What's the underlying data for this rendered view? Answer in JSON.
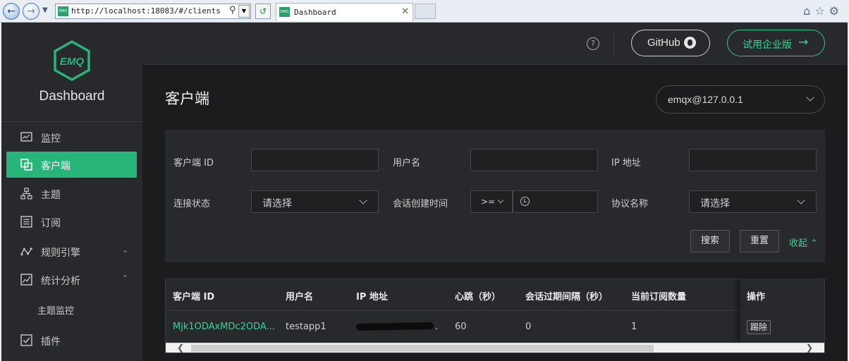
{
  "browser": {
    "url": "http://localhost:18083/#/clients",
    "tab_title": "Dashboard",
    "favicon_text": "EMQ"
  },
  "sidebar": {
    "logo_text": "EMQ",
    "brand": "Dashboard",
    "items": [
      {
        "label": "监控",
        "icon": "monitor-icon"
      },
      {
        "label": "客户端",
        "icon": "clients-icon",
        "active": true
      },
      {
        "label": "主题",
        "icon": "topics-icon"
      },
      {
        "label": "订阅",
        "icon": "subscriptions-icon"
      },
      {
        "label": "规则引擎",
        "icon": "rule-engine-icon",
        "expandable": true
      },
      {
        "label": "统计分析",
        "icon": "analysis-icon",
        "expanded": true
      },
      {
        "label": "主题监控",
        "sub": true
      },
      {
        "label": "插件",
        "icon": "plugins-icon"
      }
    ]
  },
  "header": {
    "github_label": "GitHub",
    "enterprise_label": "试用企业版"
  },
  "page": {
    "title": "客户端",
    "node": "emqx@127.0.0.1"
  },
  "filters": {
    "client_id_label": "客户端 ID",
    "username_label": "用户名",
    "ip_label": "IP 地址",
    "conn_state_label": "连接状态",
    "conn_state_placeholder": "请选择",
    "created_at_label": "会话创建时间",
    "created_at_op": ">=",
    "protocol_label": "协议名称",
    "protocol_placeholder": "请选择",
    "search_button": "搜索",
    "reset_button": "重置",
    "collapse_link": "收起"
  },
  "table": {
    "columns": [
      "客户端 ID",
      "用户名",
      "IP 地址",
      "心跳（秒）",
      "会话过期间隔（秒）",
      "当前订阅数量",
      "操作"
    ],
    "rows": [
      {
        "client_id": "Mjk1ODAxMDc2ODA...",
        "username": "testapp1",
        "ip_tail": "...",
        "keepalive": "60",
        "expiry": "0",
        "subscriptions": "1",
        "action": "踢除"
      }
    ]
  },
  "colors": {
    "accent": "#27b57a",
    "accent_text": "#36d39a",
    "sidebar_bg": "#27292c",
    "main_bg": "#1c1c1e"
  }
}
